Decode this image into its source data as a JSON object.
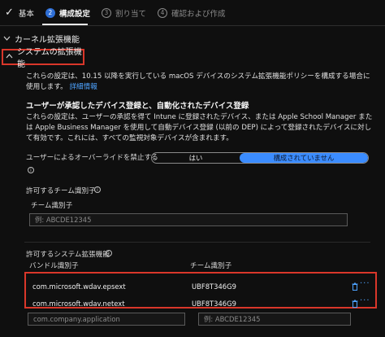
{
  "wizard": {
    "steps": [
      {
        "label": "基本",
        "state": "done",
        "number": ""
      },
      {
        "label": "構成設定",
        "state": "active",
        "number": "2"
      },
      {
        "label": "割り当て",
        "state": "pending",
        "number": "3"
      },
      {
        "label": "確認および作成",
        "state": "pending",
        "number": "4"
      }
    ]
  },
  "sections": {
    "kernel": "カーネル拡張機能",
    "system": "システムの拡張機能"
  },
  "intro": {
    "text": "これらの設定は、10.15 以降を実行している macOS デバイスのシステム拡張機能ポリシーを構成する場合に使用します。",
    "link": "詳細情報"
  },
  "approval": {
    "heading": "ユーザーが承認したデバイス登録と、自動化されたデバイス登録",
    "text": "これらの設定は、ユーザーの承認を得て Intune に登録されたデバイス、または Apple School Manager または Apple Business Manager を使用して自動デバイス登録 (以前の DEP) によって登録されたデバイスに対して有効です。これには、すべての監視対象デバイスが含まれます。"
  },
  "override": {
    "label": "ユーザーによるオーバーライドを禁止する",
    "yes": "はい",
    "no": "構成されていません",
    "selected": "構成されていません"
  },
  "allowed_teams": {
    "label": "許可するチーム識別子",
    "column": "チーム識別子",
    "placeholder": "例: ABCDE12345"
  },
  "allowed_extensions": {
    "label": "許可するシステム拡張機能",
    "col_bundle": "バンドル識別子",
    "col_team": "チーム識別子",
    "rows": [
      {
        "bundle": "com.microsoft.wdav.epsext",
        "team": "UBF8T346G9"
      },
      {
        "bundle": "com.microsoft.wdav.netext",
        "team": "UBF8T346G9"
      }
    ],
    "placeholder_bundle": "com.company.application",
    "placeholder_team": "例: ABCDE12345"
  },
  "colors": {
    "accent": "#3b8cff",
    "highlight": "#d9372a",
    "link": "#4ea3ff"
  }
}
